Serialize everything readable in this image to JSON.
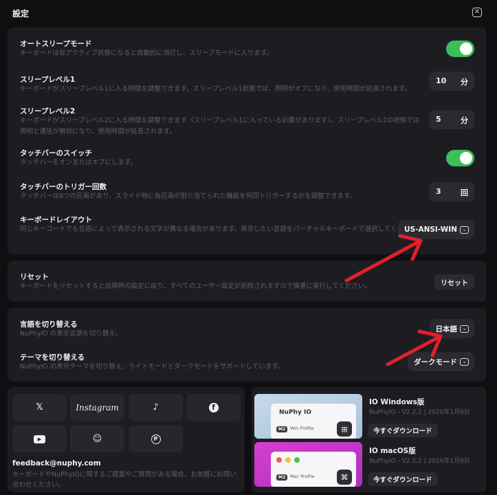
{
  "window": {
    "title": "設定"
  },
  "settings": {
    "auto_sleep": {
      "title": "オートスリープモード",
      "desc": "キーボードは非アクティブ状態になると自動的に消灯し、スリープモードに入ります。",
      "enabled": true
    },
    "sleep_level_1": {
      "title": "スリープレベル1",
      "desc": "キーボードがスリープレベル1に入る時間を調整できます。スリープレベル1状態では、照明がオフになり、使用時間が延長されます。",
      "value": "10",
      "unit": "分"
    },
    "sleep_level_2": {
      "title": "スリープレベル2",
      "desc_line1": "キーボードがスリープレベル2に入る時間を調整できます（スリープレベル1に入っている必要があります）。スリープレベル2の状態では",
      "desc_line2": "照明と通信が無効になり、使用時間が延長されます。",
      "value": "5",
      "unit": "分"
    },
    "touchbar_switch": {
      "title": "タッチバーのスイッチ",
      "desc": "タッチバーをオンまたはオフにします。",
      "enabled": true
    },
    "touchbar_trigger": {
      "title": "タッチバーのトリガー回数",
      "desc": "タッチバーは6つの区画があり、スライド時に各区画が割り当てられた機能を何回トリガーするかを調整できます。",
      "value": "3",
      "unit": "回"
    },
    "keyboard_layout": {
      "title": "キーボードレイアウト",
      "desc": "同じキーコードでも言語によって表示される文字が異なる場合があります。表示したい言語をバーチャルキーボードで選択してくださ",
      "selected": "US-ANSI-WIN"
    }
  },
  "reset": {
    "title": "リセット",
    "desc": "キーボードをリセットすると出荷時の設定に戻り、すべてのユーザー設定が削除されますので慎重に実行してください。",
    "button": "リセット"
  },
  "language": {
    "title": "言語を切り替える",
    "desc": "NuPhyIO の表示言語を切り替え。",
    "selected": "日本語"
  },
  "theme": {
    "title": "テーマを切り替える",
    "desc": "NuPhyIO の表示テーマを切り替え、ライトモードとダークモードをサポートしています。",
    "selected": "ダークモード"
  },
  "social": {
    "x": "𝕏",
    "instagram": "Instagram",
    "tiktok": "♪",
    "facebook": "f",
    "youtube": "▶",
    "discord": "☺",
    "pinterest": "P",
    "feedback_email": "feedback@nuphy.com",
    "feedback_desc": "キーボードやNuPhyIOに関するご提案やご質問がある場合、お気軽にお問い合わせください。"
  },
  "downloads": {
    "windows": {
      "card_title": "NuPhy IO",
      "badge": "M2",
      "badge_label": "Win Profile",
      "title": "IO Windows版",
      "meta": "NuPhyIO - V2.2.2 | 2026年1月8日",
      "button": "今すぐダウンロード"
    },
    "mac": {
      "badge": "M2",
      "badge_label": "Mac Profile",
      "title": "IO macOS版",
      "meta": "NuPhyIO - V2.2.2 | 2026年1月8日",
      "button": "今すぐダウンロード"
    }
  },
  "colors": {
    "toggle_on": "#3bbf5b",
    "arrow": "#e3202b",
    "panel": "#1d1d21",
    "mac_accent": "#c936c9"
  }
}
